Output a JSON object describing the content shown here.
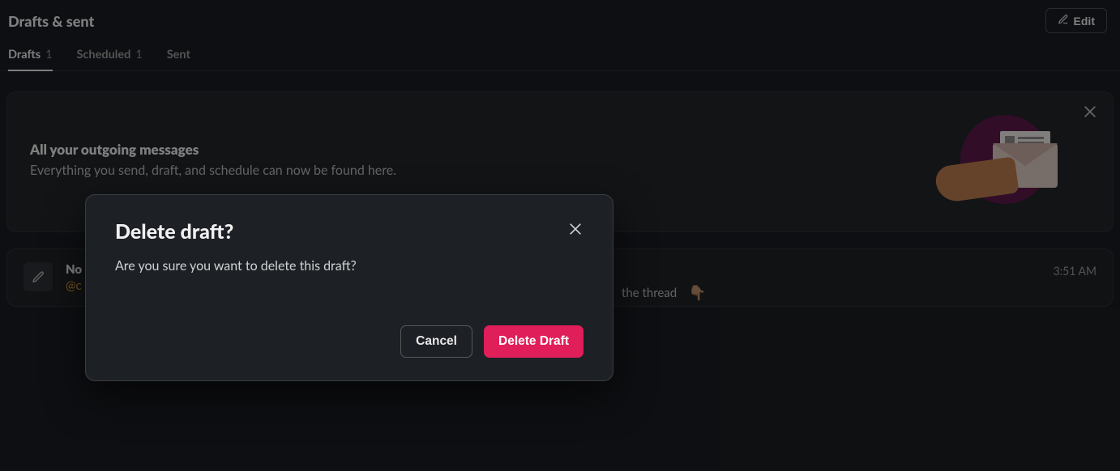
{
  "page": {
    "title": "Drafts & sent"
  },
  "header": {
    "edit_label": "Edit"
  },
  "tabs": {
    "drafts": {
      "label": "Drafts",
      "count": "1"
    },
    "scheduled": {
      "label": "Scheduled",
      "count": "1"
    },
    "sent": {
      "label": "Sent"
    }
  },
  "banner": {
    "title": "All your outgoing messages",
    "subtitle": "Everything you send, draft, and schedule can now be found here."
  },
  "draft": {
    "title_visible": "No",
    "mention_visible": "@c",
    "body_fragment": "the thread",
    "emoji": "👇🏽",
    "time": "3:51 AM"
  },
  "modal": {
    "title": "Delete draft?",
    "body": "Are you sure you want to delete this draft?",
    "cancel": "Cancel",
    "confirm": "Delete Draft"
  }
}
